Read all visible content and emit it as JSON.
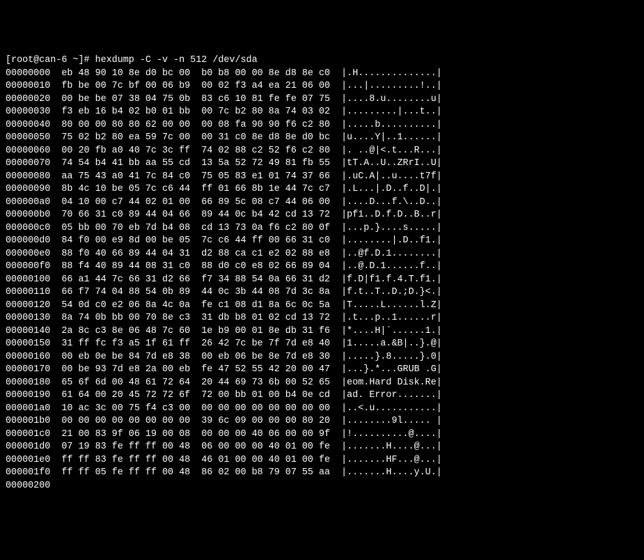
{
  "prompt": {
    "user": "root",
    "host": "can-6",
    "cwd": "~",
    "symbol": "#",
    "command": "hexdump -C -v -n 512 /dev/sda"
  },
  "hex_lines": [
    {
      "offset": "00000000",
      "hex": "eb 48 90 10 8e d0 bc 00  b0 b8 00 00 8e d8 8e c0",
      "ascii": "|.H..............|"
    },
    {
      "offset": "00000010",
      "hex": "fb be 00 7c bf 00 06 b9  00 02 f3 a4 ea 21 06 00",
      "ascii": "|...|.........!..|"
    },
    {
      "offset": "00000020",
      "hex": "00 be be 07 38 04 75 0b  83 c6 10 81 fe fe 07 75",
      "ascii": "|....8.u........u|"
    },
    {
      "offset": "00000030",
      "hex": "f3 eb 16 b4 02 b0 01 bb  00 7c b2 80 8a 74 03 02",
      "ascii": "|.........|...t..|"
    },
    {
      "offset": "00000040",
      "hex": "80 00 00 80 80 62 00 00  00 08 fa 90 90 f6 c2 80",
      "ascii": "|.....b..........|"
    },
    {
      "offset": "00000050",
      "hex": "75 02 b2 80 ea 59 7c 00  00 31 c0 8e d8 8e d0 bc",
      "ascii": "|u....Y|..1......|"
    },
    {
      "offset": "00000060",
      "hex": "00 20 fb a0 40 7c 3c ff  74 02 88 c2 52 f6 c2 80",
      "ascii": "|. ..@|<.t...R...|"
    },
    {
      "offset": "00000070",
      "hex": "74 54 b4 41 bb aa 55 cd  13 5a 52 72 49 81 fb 55",
      "ascii": "|tT.A..U..ZRrI..U|"
    },
    {
      "offset": "00000080",
      "hex": "aa 75 43 a0 41 7c 84 c0  75 05 83 e1 01 74 37 66",
      "ascii": "|.uC.A|..u....t7f|"
    },
    {
      "offset": "00000090",
      "hex": "8b 4c 10 be 05 7c c6 44  ff 01 66 8b 1e 44 7c c7",
      "ascii": "|.L...|.D..f..D|.|"
    },
    {
      "offset": "000000a0",
      "hex": "04 10 00 c7 44 02 01 00  66 89 5c 08 c7 44 06 00",
      "ascii": "|....D...f.\\..D..|"
    },
    {
      "offset": "000000b0",
      "hex": "70 66 31 c0 89 44 04 66  89 44 0c b4 42 cd 13 72",
      "ascii": "|pf1..D.f.D..B..r|"
    },
    {
      "offset": "000000c0",
      "hex": "05 bb 00 70 eb 7d b4 08  cd 13 73 0a f6 c2 80 0f",
      "ascii": "|...p.}....s.....|"
    },
    {
      "offset": "000000d0",
      "hex": "84 f0 00 e9 8d 00 be 05  7c c6 44 ff 00 66 31 c0",
      "ascii": "|........|.D..f1.|"
    },
    {
      "offset": "000000e0",
      "hex": "88 f0 40 66 89 44 04 31  d2 88 ca c1 e2 02 88 e8",
      "ascii": "|..@f.D.1........|"
    },
    {
      "offset": "000000f0",
      "hex": "88 f4 40 89 44 08 31 c0  88 d0 c0 e8 02 66 89 04",
      "ascii": "|..@.D.1......f..|"
    },
    {
      "offset": "00000100",
      "hex": "66 a1 44 7c 66 31 d2 66  f7 34 88 54 0a 66 31 d2",
      "ascii": "|f.D|f1.f.4.T.f1.|"
    },
    {
      "offset": "00000110",
      "hex": "66 f7 74 04 88 54 0b 89  44 0c 3b 44 08 7d 3c 8a",
      "ascii": "|f.t..T..D.;D.}<.|"
    },
    {
      "offset": "00000120",
      "hex": "54 0d c0 e2 06 8a 4c 0a  fe c1 08 d1 8a 6c 0c 5a",
      "ascii": "|T.....L......l.Z|"
    },
    {
      "offset": "00000130",
      "hex": "8a 74 0b bb 00 70 8e c3  31 db b8 01 02 cd 13 72",
      "ascii": "|.t...p..1......r|"
    },
    {
      "offset": "00000140",
      "hex": "2a 8c c3 8e 06 48 7c 60  1e b9 00 01 8e db 31 f6",
      "ascii": "|*....H|`......1.|"
    },
    {
      "offset": "00000150",
      "hex": "31 ff fc f3 a5 1f 61 ff  26 42 7c be 7f 7d e8 40",
      "ascii": "|1.....a.&B|..}.@|"
    },
    {
      "offset": "00000160",
      "hex": "00 eb 0e be 84 7d e8 38  00 eb 06 be 8e 7d e8 30",
      "ascii": "|.....}.8.....}.0|"
    },
    {
      "offset": "00000170",
      "hex": "00 be 93 7d e8 2a 00 eb  fe 47 52 55 42 20 00 47",
      "ascii": "|...}.*...GRUB .G|"
    },
    {
      "offset": "00000180",
      "hex": "65 6f 6d 00 48 61 72 64  20 44 69 73 6b 00 52 65",
      "ascii": "|eom.Hard Disk.Re|"
    },
    {
      "offset": "00000190",
      "hex": "61 64 00 20 45 72 72 6f  72 00 bb 01 00 b4 0e cd",
      "ascii": "|ad. Error.......|"
    },
    {
      "offset": "000001a0",
      "hex": "10 ac 3c 00 75 f4 c3 00  00 00 00 00 00 00 00 00",
      "ascii": "|..<.u...........|"
    },
    {
      "offset": "000001b0",
      "hex": "00 00 00 00 00 00 00 00  39 6c 09 00 00 00 80 20",
      "ascii": "|........9l..... |"
    },
    {
      "offset": "000001c0",
      "hex": "21 00 83 9f 06 19 00 08  00 00 00 40 06 00 00 9f",
      "ascii": "|!..........@....|"
    },
    {
      "offset": "000001d0",
      "hex": "07 19 83 fe ff ff 00 48  06 00 00 00 40 01 00 fe",
      "ascii": "|.......H....@...|"
    },
    {
      "offset": "000001e0",
      "hex": "ff ff 83 fe ff ff 00 48  46 01 00 00 40 01 00 fe",
      "ascii": "|.......HF...@...|"
    },
    {
      "offset": "000001f0",
      "hex": "ff ff 05 fe ff ff 00 48  86 02 00 b8 79 07 55 aa",
      "ascii": "|.......H....y.U.|"
    }
  ],
  "end_offset": "00000200"
}
